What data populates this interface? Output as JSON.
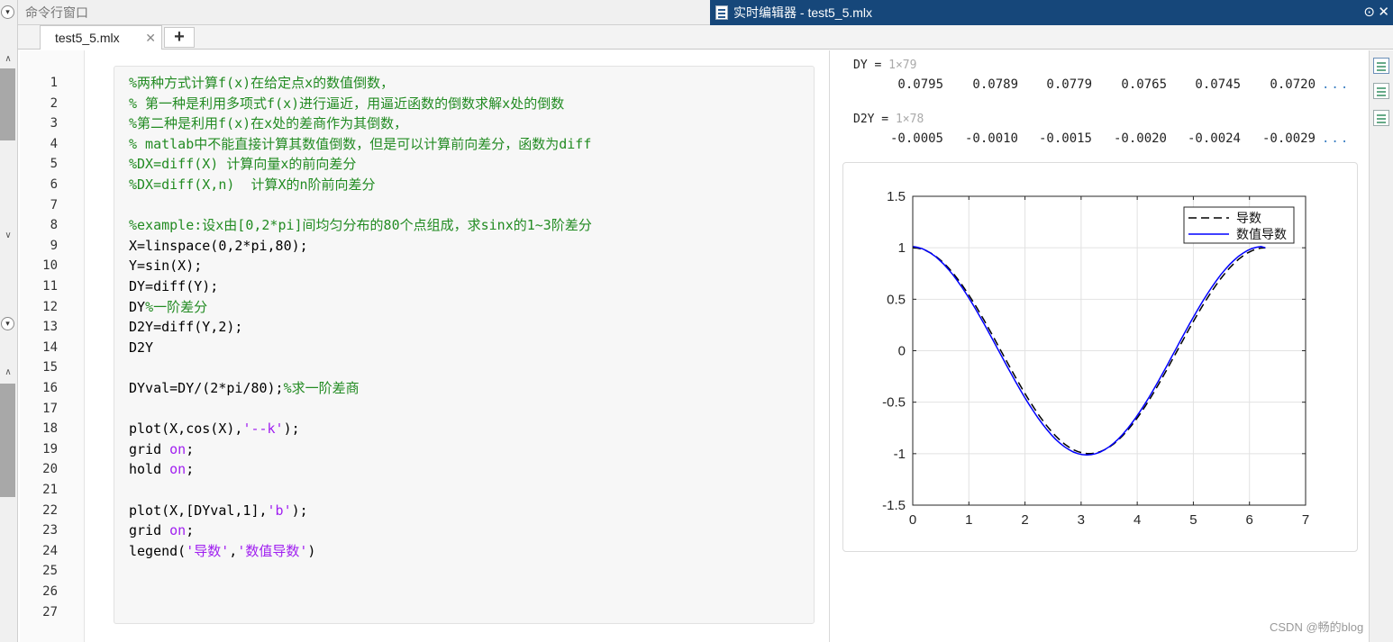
{
  "left_panel": {
    "title": "命令行窗口"
  },
  "editor": {
    "title": "实时编辑器 - test5_5.mlx",
    "tab_label": "test5_5.mlx",
    "tab_close": "✕",
    "tab_add": "+"
  },
  "code_lines": [
    [
      {
        "t": "%两种方式计算f(x)在给定点x的数值倒数，",
        "c": "cmt"
      }
    ],
    [
      {
        "t": "% 第一种是利用多项式f(x)进行逼近，用逼近函数的倒数求解x处的倒数",
        "c": "cmt"
      }
    ],
    [
      {
        "t": "%第二种是利用f(x)在x处的差商作为其倒数，",
        "c": "cmt"
      }
    ],
    [
      {
        "t": "% matlab中不能直接计算其数值倒数，但是可以计算前向差分，函数为diff",
        "c": "cmt"
      }
    ],
    [
      {
        "t": "%DX=diff(X) 计算向量x的前向差分",
        "c": "cmt"
      }
    ],
    [
      {
        "t": "%DX=diff(X,n)  计算X的n阶前向差分",
        "c": "cmt"
      }
    ],
    [],
    [
      {
        "t": "%example:设x由[0,2*pi]间均匀分布的80个点组成，求sinx的1~3阶差分",
        "c": "cmt"
      }
    ],
    [
      {
        "t": "X=linspace(0,2*pi,80);",
        "c": ""
      }
    ],
    [
      {
        "t": "Y=sin(X);",
        "c": ""
      }
    ],
    [
      {
        "t": "DY=diff(Y);",
        "c": ""
      }
    ],
    [
      {
        "t": "DY",
        "c": ""
      },
      {
        "t": "%一阶差分",
        "c": "cmt"
      }
    ],
    [
      {
        "t": "D2Y=diff(Y,2);",
        "c": ""
      }
    ],
    [
      {
        "t": "D2Y",
        "c": ""
      }
    ],
    [],
    [
      {
        "t": "DYval=DY/(2*pi/80);",
        "c": ""
      },
      {
        "t": "%求一阶差商",
        "c": "cmt"
      }
    ],
    [],
    [
      {
        "t": "plot(X,cos(X),",
        "c": ""
      },
      {
        "t": "'--k'",
        "c": "str"
      },
      {
        "t": ");",
        "c": ""
      }
    ],
    [
      {
        "t": "grid ",
        "c": ""
      },
      {
        "t": "on",
        "c": "kw"
      },
      {
        "t": ";",
        "c": ""
      }
    ],
    [
      {
        "t": "hold ",
        "c": ""
      },
      {
        "t": "on",
        "c": "kw"
      },
      {
        "t": ";",
        "c": ""
      }
    ],
    [],
    [
      {
        "t": "plot(X,[DYval,1],",
        "c": ""
      },
      {
        "t": "'b'",
        "c": "str"
      },
      {
        "t": ");",
        "c": ""
      }
    ],
    [
      {
        "t": "grid ",
        "c": ""
      },
      {
        "t": "on",
        "c": "kw"
      },
      {
        "t": ";",
        "c": ""
      }
    ],
    [
      {
        "t": "legend(",
        "c": ""
      },
      {
        "t": "'导数'",
        "c": "str"
      },
      {
        "t": ",",
        "c": ""
      },
      {
        "t": "'数值导数'",
        "c": "str"
      },
      {
        "t": ")",
        "c": ""
      }
    ],
    [],
    [],
    []
  ],
  "outputs": {
    "dy": {
      "name": "DY =",
      "dim": "1×79",
      "values": [
        "0.0795",
        "0.0789",
        "0.0779",
        "0.0765",
        "0.0745",
        "0.0720"
      ],
      "more": "..."
    },
    "d2y": {
      "name": "D2Y =",
      "dim": "1×78",
      "values": [
        "-0.0005",
        "-0.0010",
        "-0.0015",
        "-0.0020",
        "-0.0024",
        "-0.0029"
      ],
      "more": "..."
    }
  },
  "chart_data": {
    "type": "line",
    "title": "",
    "xlabel": "",
    "ylabel": "",
    "xlim": [
      0,
      7
    ],
    "ylim": [
      -1.5,
      1.5
    ],
    "xticks": [
      0,
      1,
      2,
      3,
      4,
      5,
      6,
      7
    ],
    "yticks": [
      1.5,
      1,
      0.5,
      0,
      -0.5,
      -1,
      -1.5
    ],
    "grid": true,
    "legend_position": "top-right",
    "series": [
      {
        "name": "导数",
        "function": "cos(x)",
        "x_range": [
          0,
          6.2832
        ],
        "points": 80,
        "style": "dashed",
        "color": "#000000"
      },
      {
        "name": "数值导数",
        "function": "forward difference of sin(x) / (2*pi/80)",
        "x_range": [
          0,
          6.2832
        ],
        "points": 80,
        "style": "solid",
        "color": "#0000ff"
      }
    ]
  },
  "watermark": "CSDN @畅的blog",
  "icons": [
    "collapse-icon",
    "doc-icon",
    "close-icon",
    "add-tab-icon",
    "output-inline-icon",
    "output-right-icon",
    "text-mode-icon"
  ]
}
